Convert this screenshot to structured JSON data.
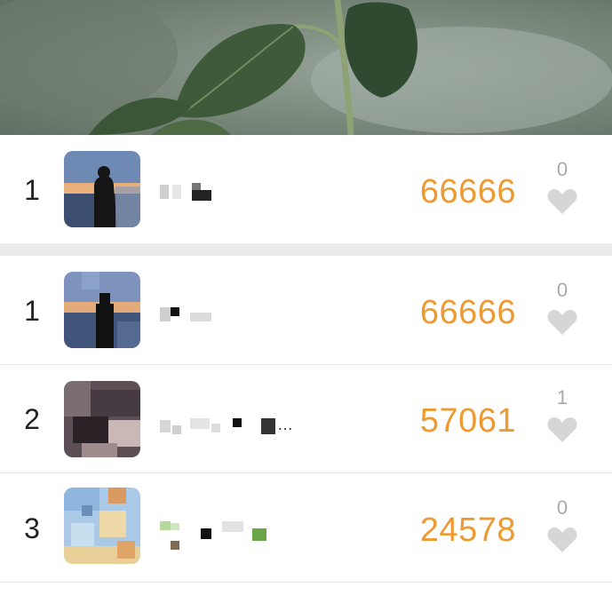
{
  "rows": [
    {
      "rank": "1",
      "score": "66666",
      "likes": "0",
      "name_text": ""
    },
    {
      "rank": "1",
      "score": "66666",
      "likes": "0",
      "name_text": ""
    },
    {
      "rank": "2",
      "score": "57061",
      "likes": "1",
      "name_text": "…"
    },
    {
      "rank": "3",
      "score": "24578",
      "likes": "0",
      "name_text": ""
    }
  ],
  "colors": {
    "score": "#ee9a32",
    "heart": "#d6d6d6",
    "divider": "#ebebeb"
  },
  "icons": {
    "like": "heart-icon"
  }
}
